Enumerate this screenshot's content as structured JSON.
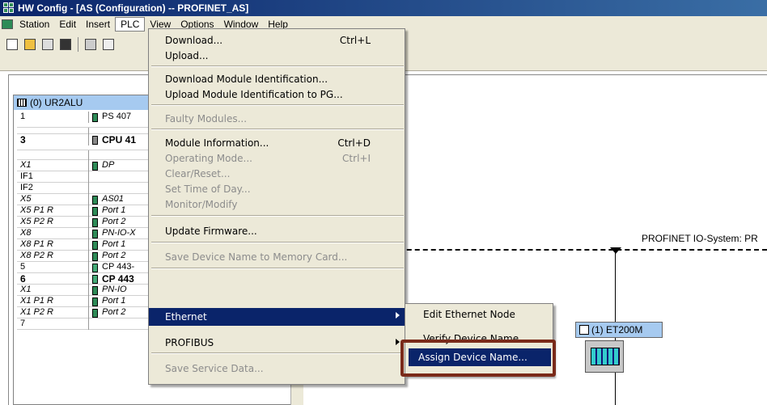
{
  "window": {
    "title": "HW Config - [AS (Configuration) -- PROFINET_AS]"
  },
  "menubar": {
    "items": [
      "Station",
      "Edit",
      "Insert",
      "PLC",
      "View",
      "Options",
      "Window",
      "Help"
    ],
    "active": "PLC"
  },
  "rack": {
    "title": "(0) UR2ALU",
    "rows": [
      {
        "slot": "1",
        "module": "PS 407"
      },
      {
        "slot": "3",
        "module": "CPU 41"
      },
      {
        "slot": "X1",
        "module": "DP"
      },
      {
        "slot": "IF1",
        "module": ""
      },
      {
        "slot": "IF2",
        "module": ""
      },
      {
        "slot": "X5",
        "module": "AS01"
      },
      {
        "slot": "X5 P1 R",
        "module": "Port 1"
      },
      {
        "slot": "X5 P2 R",
        "module": "Port 2"
      },
      {
        "slot": "X8",
        "module": "PN-IO-X"
      },
      {
        "slot": "X8 P1 R",
        "module": "Port 1"
      },
      {
        "slot": "X8 P2 R",
        "module": "Port 2"
      },
      {
        "slot": "5",
        "module": "CP 443-"
      },
      {
        "slot": "6",
        "module": "CP 443"
      },
      {
        "slot": "X1",
        "module": "PN-IO"
      },
      {
        "slot": "X1 P1 R",
        "module": "Port 1"
      },
      {
        "slot": "X1 P2 R",
        "module": "Port 2"
      },
      {
        "slot": "7",
        "module": ""
      }
    ]
  },
  "plc_menu": {
    "download": "Download...",
    "download_sc": "Ctrl+L",
    "upload": "Upload...",
    "download_id": "Download Module Identification...",
    "upload_id": "Upload Module Identification to PG...",
    "faulty": "Faulty Modules...",
    "module_info": "Module Information...",
    "module_info_sc": "Ctrl+D",
    "operating_mode": "Operating Mode...",
    "operating_mode_sc": "Ctrl+I",
    "clear_reset": "Clear/Reset...",
    "set_time": "Set Time of Day...",
    "monitor": "Monitor/Modify",
    "update_fw": "Update Firmware...",
    "save_name": "Save Device Name to Memory Card...",
    "ethernet": "Ethernet",
    "profibus": "PROFIBUS",
    "save_service": "Save Service Data..."
  },
  "ethernet_submenu": {
    "edit_node": "Edit Ethernet Node",
    "verify_name": "Verify Device Name",
    "assign_name": "Assign Device Name..."
  },
  "network": {
    "bus_label": "PROFINET IO-System: PR",
    "device_label": "(1) ET200M"
  }
}
